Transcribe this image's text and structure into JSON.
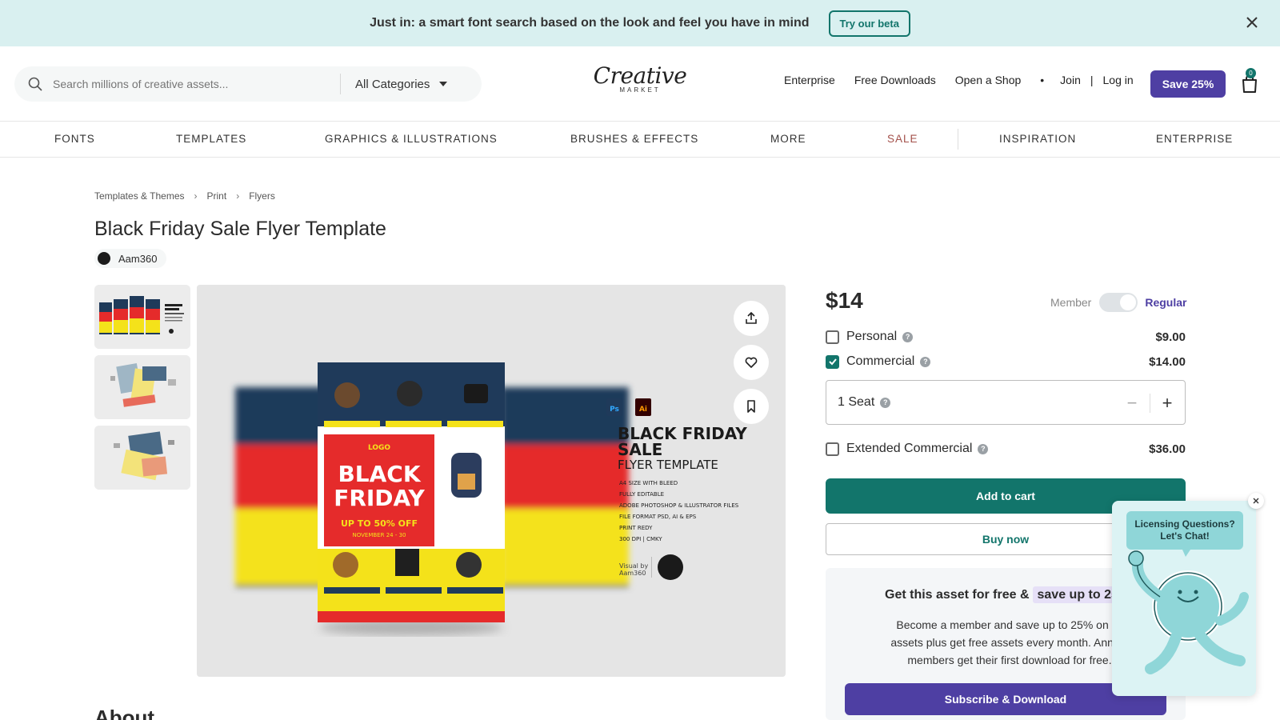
{
  "banner": {
    "text": "Just in: a smart font search based on the look and feel you have in mind",
    "button": "Try our beta"
  },
  "header": {
    "search_placeholder": "Search millions of creative assets...",
    "category": "All Categories",
    "logo_main": "Creative",
    "logo_sub": "MARKET",
    "links": [
      "Enterprise",
      "Free Downloads",
      "Open a Shop"
    ],
    "dot": "•",
    "join": "Join",
    "separator": "|",
    "login": "Log in",
    "save_button": "Save 25%",
    "cart_count": "0"
  },
  "nav": {
    "fonts": "FONTS",
    "templates": "TEMPLATES",
    "graphics": "GRAPHICS & ILLUSTRATIONS",
    "brushes": "BRUSHES & EFFECTS",
    "more": "MORE",
    "sale": "SALE",
    "inspiration": "INSPIRATION",
    "enterprise": "ENTERPRISE"
  },
  "breadcrumb": [
    "Templates & Themes",
    "Print",
    "Flyers"
  ],
  "product": {
    "title": "Black Friday Sale Flyer Template",
    "author": "Aam360"
  },
  "preview": {
    "heading1": "BLACK FRIDAY",
    "heading2": "SALE",
    "heading3": "FLYER TEMPLATE",
    "features": [
      "A4 SIZE WITH BLEED",
      "FULLY EDITABLE",
      "ADOBE PHOTOSHOP & ILLUSTRATOR FILES",
      "FILE FORMAT PSD, AI & EPS",
      "PRINT REDY",
      "300 DPI | CMKY"
    ],
    "visual_by": "Visual by",
    "visual_by_name": "Aam360",
    "flyer_black": "BLACK",
    "flyer_friday": "FRIDAY",
    "flyer_offer": "UP TO 50% OFF",
    "flyer_dates": "NOVEMBER 24 - 30",
    "flyer_logo": "LOGO"
  },
  "pricing": {
    "price": "$14",
    "member_label": "Member",
    "regular_label": "Regular",
    "personal": "Personal",
    "personal_price": "$9.00",
    "commercial": "Commercial",
    "commercial_price": "$14.00",
    "seat": "1 Seat",
    "extended": "Extended Commercial",
    "extended_price": "$36.00",
    "add_to_cart": "Add to cart",
    "buy_now": "Buy now"
  },
  "promo": {
    "title": "Get this asset for free &",
    "highlight": "save up to 25%",
    "body": "Become a member and save up to 25% on all assets plus get free assets every month. Annual members get their first download for free.",
    "subscribe": "Subscribe & Download"
  },
  "about": "About",
  "chat": {
    "bubble": "Licensing Questions? Let's Chat!"
  },
  "colors": {
    "brand_teal": "#12756b",
    "brand_purple": "#4e3fa3",
    "banner_bg": "#d9f0f0",
    "sale_red": "#a3504a"
  }
}
